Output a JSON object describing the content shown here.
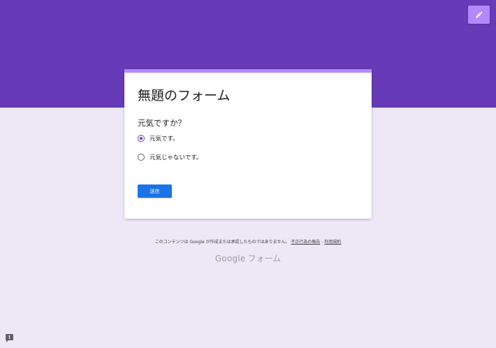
{
  "colors": {
    "header": "#673ab7",
    "accent_light": "#b388ff",
    "page_background": "#ede7f6",
    "submit_button": "#1a73e8"
  },
  "toolbar": {
    "edit_icon": "pencil-icon"
  },
  "form": {
    "title": "無題のフォーム",
    "question": "元気ですか？",
    "options": [
      {
        "label": "元気です。",
        "selected": true
      },
      {
        "label": "元気じゃないです。",
        "selected": false
      }
    ],
    "submit_label": "送信"
  },
  "footer": {
    "disclaimer": "このコンテンツは Google が作成または承認したものではありません。",
    "report_link": "不正行為の報告",
    "separator": " - ",
    "terms_link": "利用規約",
    "brand_google": "Google",
    "brand_forms": "フォーム"
  },
  "report_button": {
    "icon": "report-issue-icon",
    "glyph": "!"
  }
}
